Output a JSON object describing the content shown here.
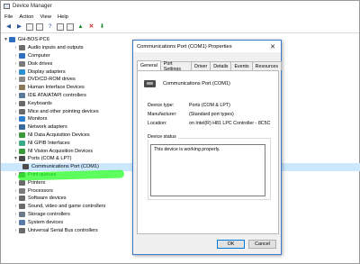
{
  "window": {
    "title": "Device Manager"
  },
  "menu": [
    "File",
    "Action",
    "View",
    "Help"
  ],
  "tree": {
    "root": "GH-BOS-PC6",
    "items": [
      {
        "label": "Audio inputs and outputs",
        "icon": "speaker-icon",
        "color": "#6d6d6d"
      },
      {
        "label": "Computer",
        "icon": "computer-icon",
        "color": "#2f6fbf"
      },
      {
        "label": "Disk drives",
        "icon": "disk-drive-icon",
        "color": "#7a7a7a"
      },
      {
        "label": "Display adapters",
        "icon": "display-adapter-icon",
        "color": "#2f8fcf"
      },
      {
        "label": "DVD/CD-ROM drives",
        "icon": "dvd-drive-icon",
        "color": "#8a8a8a"
      },
      {
        "label": "Human Interface Devices",
        "icon": "hid-icon",
        "color": "#8a7a5a"
      },
      {
        "label": "IDE ATA/ATAPI controllers",
        "icon": "ide-controller-icon",
        "color": "#5a7a9a"
      },
      {
        "label": "Keyboards",
        "icon": "keyboard-icon",
        "color": "#6a6a6a"
      },
      {
        "label": "Mice and other pointing devices",
        "icon": "mouse-icon",
        "color": "#6a6a6a"
      },
      {
        "label": "Monitors",
        "icon": "monitor-icon",
        "color": "#2f7fcf"
      },
      {
        "label": "Network adapters",
        "icon": "network-adapter-icon",
        "color": "#3a6a9a"
      },
      {
        "label": "NI Data Acquisition Devices",
        "icon": "ni-daq-icon",
        "color": "#3a9a3a"
      },
      {
        "label": "NI GPIB Interfaces",
        "icon": "ni-gpib-icon",
        "color": "#3aaa8a"
      },
      {
        "label": "NI Vision Acquisition Devices",
        "icon": "ni-vision-icon",
        "color": "#3a9a3a"
      },
      {
        "label": "Ports (COM & LPT)",
        "icon": "ports-icon",
        "color": "#4a4a4a",
        "expanded": true
      },
      {
        "label": "Print queues",
        "icon": "print-queue-icon",
        "color": "#6a6a6a"
      },
      {
        "label": "Printers",
        "icon": "printer-icon",
        "color": "#6a6a6a"
      },
      {
        "label": "Processors",
        "icon": "processor-icon",
        "color": "#7a7a7a"
      },
      {
        "label": "Software devices",
        "icon": "software-device-icon",
        "color": "#6a6a6a"
      },
      {
        "label": "Sound, video and game controllers",
        "icon": "sound-icon",
        "color": "#6d6d6d"
      },
      {
        "label": "Storage controllers",
        "icon": "storage-controller-icon",
        "color": "#6a7a8a"
      },
      {
        "label": "System devices",
        "icon": "system-device-icon",
        "color": "#5a7aaa"
      },
      {
        "label": "Universal Serial Bus controllers",
        "icon": "usb-icon",
        "color": "#6a6a6a"
      }
    ],
    "child": {
      "label": "Communications Port (COM1)",
      "icon": "com-port-icon",
      "color": "#4a4a4a"
    }
  },
  "dialog": {
    "title": "Communications Port (COM1) Properties",
    "close": "✕",
    "tabs": [
      "General",
      "Port Settings",
      "Driver",
      "Details",
      "Events",
      "Resources"
    ],
    "device_name": "Communications Port (COM1)",
    "labels": {
      "type": "Device type:",
      "manufacturer": "Manufacturer:",
      "location": "Location:"
    },
    "values": {
      "type": "Ports (COM & LPT)",
      "manufacturer": "(Standard port types)",
      "location": "on Intel(R) H81 LPC Controller - 8C5C"
    },
    "status_label": "Device status",
    "status_text": "This device is working properly.",
    "ok": "OK",
    "cancel": "Cancel"
  },
  "colors": {
    "highlight": "#1dff1d",
    "selection": "#cce8ff",
    "accent": "#0078d7"
  }
}
